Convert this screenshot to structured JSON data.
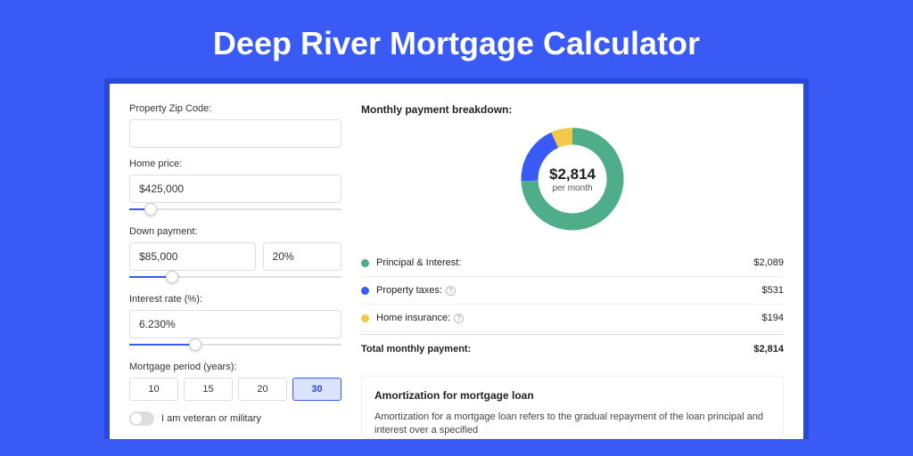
{
  "title": "Deep River Mortgage Calculator",
  "form": {
    "zip_label": "Property Zip Code:",
    "zip_value": "",
    "home_price_label": "Home price:",
    "home_price_value": "$425,000",
    "down_label": "Down payment:",
    "down_value": "$85,000",
    "down_pct": "20%",
    "rate_label": "Interest rate (%):",
    "rate_value": "6.230%",
    "period_label": "Mortgage period (years):",
    "periods": [
      "10",
      "15",
      "20",
      "30"
    ],
    "period_selected": "30",
    "veteran_label": "I am veteran or military"
  },
  "breakdown": {
    "heading": "Monthly payment breakdown:",
    "total_amount": "$2,814",
    "per_month": "per month",
    "items": [
      {
        "label": "Principal & Interest:",
        "value": "$2,089",
        "color": "#4fae8a",
        "has_info": false
      },
      {
        "label": "Property taxes:",
        "value": "$531",
        "color": "#3a5af5",
        "has_info": true
      },
      {
        "label": "Home insurance:",
        "value": "$194",
        "color": "#f2c94c",
        "has_info": true
      }
    ],
    "total_label": "Total monthly payment:",
    "total_value": "$2,814"
  },
  "amort": {
    "heading": "Amortization for mortgage loan",
    "body": "Amortization for a mortgage loan refers to the gradual repayment of the loan principal and interest over a specified"
  },
  "chart_data": {
    "type": "pie",
    "title": "Monthly payment breakdown",
    "series": [
      {
        "name": "Principal & Interest",
        "value": 2089,
        "color": "#4fae8a"
      },
      {
        "name": "Property taxes",
        "value": 531,
        "color": "#3a5af5"
      },
      {
        "name": "Home insurance",
        "value": 194,
        "color": "#f2c94c"
      }
    ],
    "total": 2814,
    "center_label": "$2,814 per month"
  }
}
